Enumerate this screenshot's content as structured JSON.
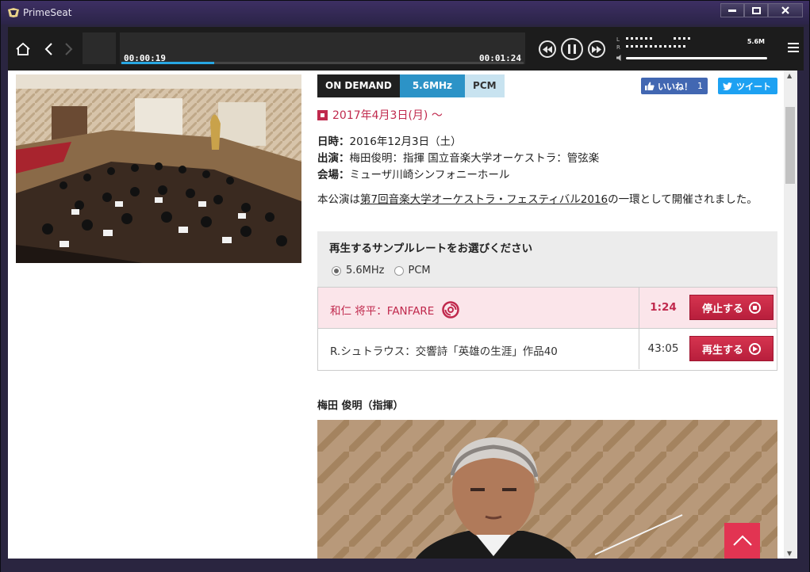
{
  "window": {
    "title": "PrimeSeat"
  },
  "player": {
    "elapsed": "00:00:19",
    "total": "00:01:24",
    "progress_fraction": 0.23,
    "meter_left_label": "L",
    "meter_right_label": "R",
    "sample_rate": "5.6M",
    "accent_color": "#28a7e2"
  },
  "tags": {
    "on_demand": "ON DEMAND",
    "dsd": "5.6MHz",
    "pcm": "PCM"
  },
  "social": {
    "like_label": "いいね！",
    "like_count": "1",
    "tweet_label": "ツイート"
  },
  "date_range": "2017年4月3日(月) ～",
  "details": {
    "date_label": "日時：",
    "date_value": "2016年12月3日（土）",
    "performers_label": "出演：",
    "performers_value": "梅田俊明：指揮 国立音楽大学オーケストラ：管弦楽",
    "venue_label": "会場：",
    "venue_value": "ミューザ川崎シンフォニーホール"
  },
  "note": {
    "prefix": "本公演は",
    "link": "第7回音楽大学オーケストラ・フェスティバル2016",
    "suffix": "の一環として開催されました。"
  },
  "rate_select": {
    "title": "再生するサンプルレートをお選びください",
    "options": [
      "5.6MHz",
      "PCM"
    ],
    "selected": "5.6MHz"
  },
  "tracks": [
    {
      "title": "和仁 将平：FANFARE",
      "duration": "1:24",
      "button": "停止する",
      "state": "playing"
    },
    {
      "title": "R.シュトラウス：交響詩「英雄の生涯」作品40",
      "duration": "43:05",
      "button": "再生する",
      "state": "stopped"
    }
  ],
  "conductor_heading": "梅田 俊明（指揮）",
  "colors": {
    "brand_red": "#c0294d",
    "button_red": "#d6344f",
    "back_to_top": "#e23452"
  }
}
